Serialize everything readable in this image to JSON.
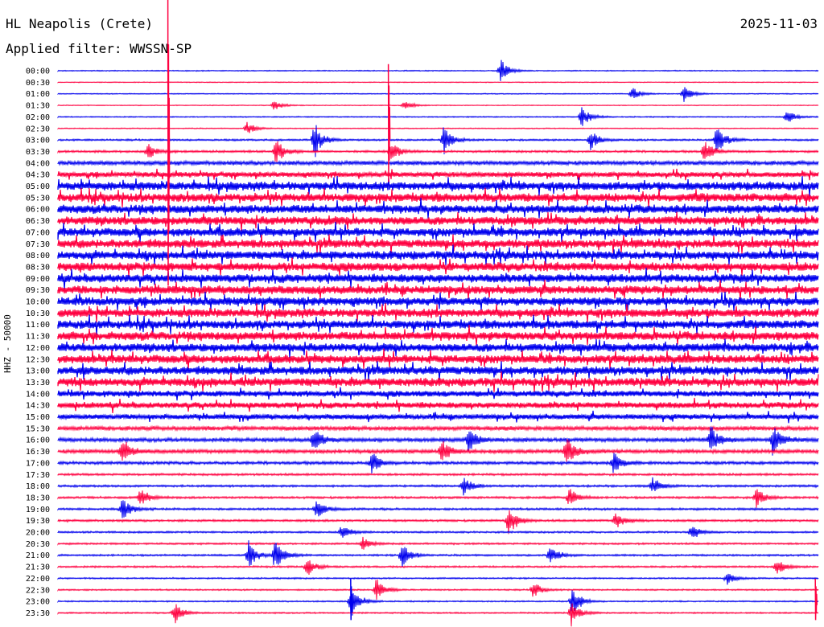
{
  "header": {
    "station": "HL Neapolis (Crete)",
    "filter_prefix": "Applied filter: ",
    "filter": "WWSSN-SP",
    "date": "2025-11-03"
  },
  "chart_data": {
    "type": "line",
    "title": "HL Neapolis (Crete)",
    "subtitle": "Applied filter: WWSSN-SP",
    "date": "2025-11-03",
    "ylabel": "HHZ - 50000",
    "row_labels": [
      "00:00",
      "00:30",
      "01:00",
      "01:30",
      "02:00",
      "02:30",
      "03:00",
      "03:30",
      "04:00",
      "04:30",
      "05:00",
      "05:30",
      "06:00",
      "06:30",
      "07:00",
      "07:30",
      "08:00",
      "08:30",
      "09:00",
      "09:30",
      "10:00",
      "10:30",
      "11:00",
      "11:30",
      "12:00",
      "12:30",
      "13:00",
      "13:30",
      "14:00",
      "14:30",
      "15:00",
      "15:30",
      "16:00",
      "16:30",
      "17:00",
      "17:30",
      "18:00",
      "18:30",
      "19:00",
      "19:30",
      "20:00",
      "20:30",
      "21:00",
      "21:30",
      "22:00",
      "22:30",
      "23:00",
      "23:30"
    ],
    "trace_colors": [
      "#0000ee",
      "#ff0040"
    ],
    "noise_level": [
      0.6,
      0.5,
      0.6,
      0.5,
      0.7,
      0.6,
      1.1,
      1.3,
      2.5,
      3.0,
      5.0,
      5.0,
      5.0,
      5.0,
      5.0,
      5.0,
      5.0,
      5.0,
      5.0,
      5.0,
      5.0,
      5.0,
      5.0,
      5.0,
      5.0,
      5.0,
      5.0,
      5.0,
      3.5,
      3.5,
      3.0,
      2.5,
      2.3,
      2.3,
      1.8,
      1.3,
      1.3,
      1.3,
      1.3,
      1.3,
      1.1,
      1.1,
      1.1,
      1.1,
      0.9,
      0.9,
      0.8,
      0.9
    ],
    "events": [
      {
        "row": 0,
        "x_frac": 0.582,
        "amp": 14
      },
      {
        "row": 2,
        "x_frac": 0.755,
        "amp": 8
      },
      {
        "row": 2,
        "x_frac": 0.823,
        "amp": 10
      },
      {
        "row": 3,
        "x_frac": 0.284,
        "amp": 7
      },
      {
        "row": 3,
        "x_frac": 0.455,
        "amp": 6
      },
      {
        "row": 4,
        "x_frac": 0.688,
        "amp": 14
      },
      {
        "row": 4,
        "x_frac": 0.958,
        "amp": 9
      },
      {
        "row": 5,
        "x_frac": 0.248,
        "amp": 8
      },
      {
        "row": 6,
        "x_frac": 0.337,
        "amp": 22
      },
      {
        "row": 6,
        "x_frac": 0.507,
        "amp": 18
      },
      {
        "row": 6,
        "x_frac": 0.7,
        "amp": 12
      },
      {
        "row": 6,
        "x_frac": 0.866,
        "amp": 20
      },
      {
        "row": 7,
        "x_frac": 0.118,
        "amp": 10
      },
      {
        "row": 7,
        "x_frac": 0.286,
        "amp": 16
      },
      {
        "row": 7,
        "x_frac": 0.438,
        "amp": 12
      },
      {
        "row": 7,
        "x_frac": 0.85,
        "amp": 14
      },
      {
        "row": 32,
        "x_frac": 0.336,
        "amp": 18
      },
      {
        "row": 32,
        "x_frac": 0.54,
        "amp": 16
      },
      {
        "row": 32,
        "x_frac": 0.858,
        "amp": 18
      },
      {
        "row": 32,
        "x_frac": 0.94,
        "amp": 20
      },
      {
        "row": 33,
        "x_frac": 0.084,
        "amp": 16
      },
      {
        "row": 33,
        "x_frac": 0.504,
        "amp": 14
      },
      {
        "row": 33,
        "x_frac": 0.668,
        "amp": 18
      },
      {
        "row": 34,
        "x_frac": 0.412,
        "amp": 14
      },
      {
        "row": 34,
        "x_frac": 0.73,
        "amp": 14
      },
      {
        "row": 36,
        "x_frac": 0.533,
        "amp": 12
      },
      {
        "row": 36,
        "x_frac": 0.781,
        "amp": 12
      },
      {
        "row": 37,
        "x_frac": 0.108,
        "amp": 12
      },
      {
        "row": 37,
        "x_frac": 0.672,
        "amp": 12
      },
      {
        "row": 37,
        "x_frac": 0.918,
        "amp": 12
      },
      {
        "row": 38,
        "x_frac": 0.084,
        "amp": 14
      },
      {
        "row": 38,
        "x_frac": 0.339,
        "amp": 14
      },
      {
        "row": 39,
        "x_frac": 0.592,
        "amp": 20
      },
      {
        "row": 39,
        "x_frac": 0.733,
        "amp": 12
      },
      {
        "row": 40,
        "x_frac": 0.373,
        "amp": 10
      },
      {
        "row": 40,
        "x_frac": 0.833,
        "amp": 10
      },
      {
        "row": 41,
        "x_frac": 0.401,
        "amp": 8
      },
      {
        "row": 42,
        "x_frac": 0.25,
        "amp": 16
      },
      {
        "row": 42,
        "x_frac": 0.285,
        "amp": 20
      },
      {
        "row": 42,
        "x_frac": 0.452,
        "amp": 16
      },
      {
        "row": 42,
        "x_frac": 0.647,
        "amp": 14
      },
      {
        "row": 43,
        "x_frac": 0.327,
        "amp": 12
      },
      {
        "row": 43,
        "x_frac": 0.945,
        "amp": 10
      },
      {
        "row": 44,
        "x_frac": 0.88,
        "amp": 8
      },
      {
        "row": 45,
        "x_frac": 0.418,
        "amp": 14
      },
      {
        "row": 45,
        "x_frac": 0.625,
        "amp": 10
      },
      {
        "row": 46,
        "x_frac": 0.385,
        "amp": 20
      },
      {
        "row": 46,
        "x_frac": 0.676,
        "amp": 18
      },
      {
        "row": 47,
        "x_frac": 0.153,
        "amp": 12
      },
      {
        "row": 47,
        "x_frac": 0.675,
        "amp": 16
      }
    ],
    "spikes": [
      {
        "row": 7,
        "x_frac": 0.1445,
        "color": "#ff0040"
      },
      {
        "row": 5,
        "x_frac": 0.4345,
        "color": "#ff0040"
      },
      {
        "row": 46,
        "x_frac": 0.385,
        "color": "#0000ee"
      },
      {
        "row": 46,
        "x_frac": 0.996,
        "color": "#ff0040"
      }
    ]
  }
}
